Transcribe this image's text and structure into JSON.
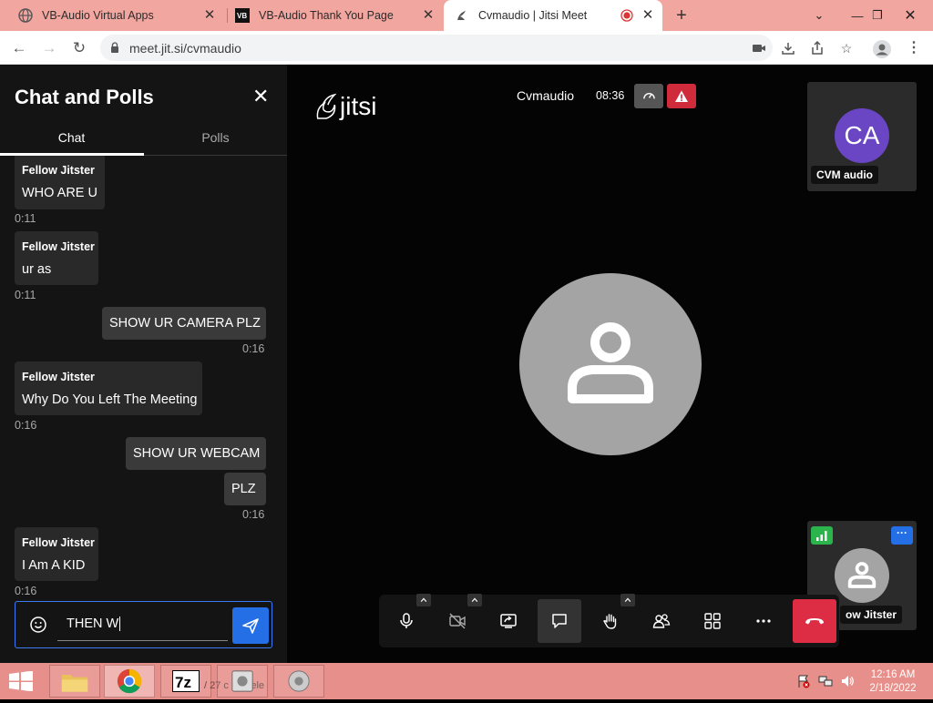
{
  "browser": {
    "tabs": [
      {
        "title": "VB-Audio Virtual Apps",
        "active": false
      },
      {
        "title": "VB-Audio Thank You Page",
        "active": false
      },
      {
        "title": "Cvmaudio | Jitsi Meet",
        "active": true
      }
    ],
    "url": "meet.jit.si/cvmaudio",
    "colors": {
      "tabstrip": "#f2a6a0",
      "taskbar": "#e78f8a"
    }
  },
  "chat": {
    "title": "Chat and Polls",
    "tabs": [
      {
        "label": "Chat"
      },
      {
        "label": "Polls"
      }
    ],
    "messages": [
      {
        "sender": "Fellow Jitster",
        "text": "WHO ARE U",
        "time": "0:11",
        "mine": false
      },
      {
        "sender": "Fellow Jitster",
        "text": "ur as",
        "time": "0:11",
        "mine": false
      },
      {
        "sender": "",
        "text": "SHOW UR CAMERA PLZ",
        "time": "0:16",
        "mine": true
      },
      {
        "sender": "Fellow Jitster",
        "text": "Why Do You Left The Meeting",
        "time": "0:16",
        "mine": false
      },
      {
        "sender": "",
        "text": "SHOW UR WEBCAM",
        "time": "",
        "mine": true
      },
      {
        "sender": "",
        "text": "PLZ",
        "time": "0:16",
        "mine": true
      },
      {
        "sender": "Fellow Jitster",
        "text": "I Am A KID",
        "time": "0:16",
        "mine": false
      }
    ],
    "input_value": "THEN W"
  },
  "meeting": {
    "logo_text": "jitsi",
    "room_name": "Cvmaudio",
    "timer": "08:36",
    "participants": [
      {
        "initials": "CA",
        "name": "CVM audio",
        "avatar_color": "#6a45c4"
      },
      {
        "name": "ow Jitster"
      }
    ],
    "toolbar_icons": [
      "microphone-icon",
      "camera-off-icon",
      "screen-share-icon",
      "chat-icon",
      "raise-hand-icon",
      "participants-icon",
      "tile-view-icon",
      "more-options-icon",
      "hangup-icon"
    ],
    "colors": {
      "hangup": "#dd2d44",
      "warning": "#cf2b3b",
      "accent": "#246fe5"
    }
  },
  "taskbar": {
    "ghost_text": "/ 27 c     (s) sele",
    "time": "12:16 AM",
    "date": "2/18/2022"
  }
}
